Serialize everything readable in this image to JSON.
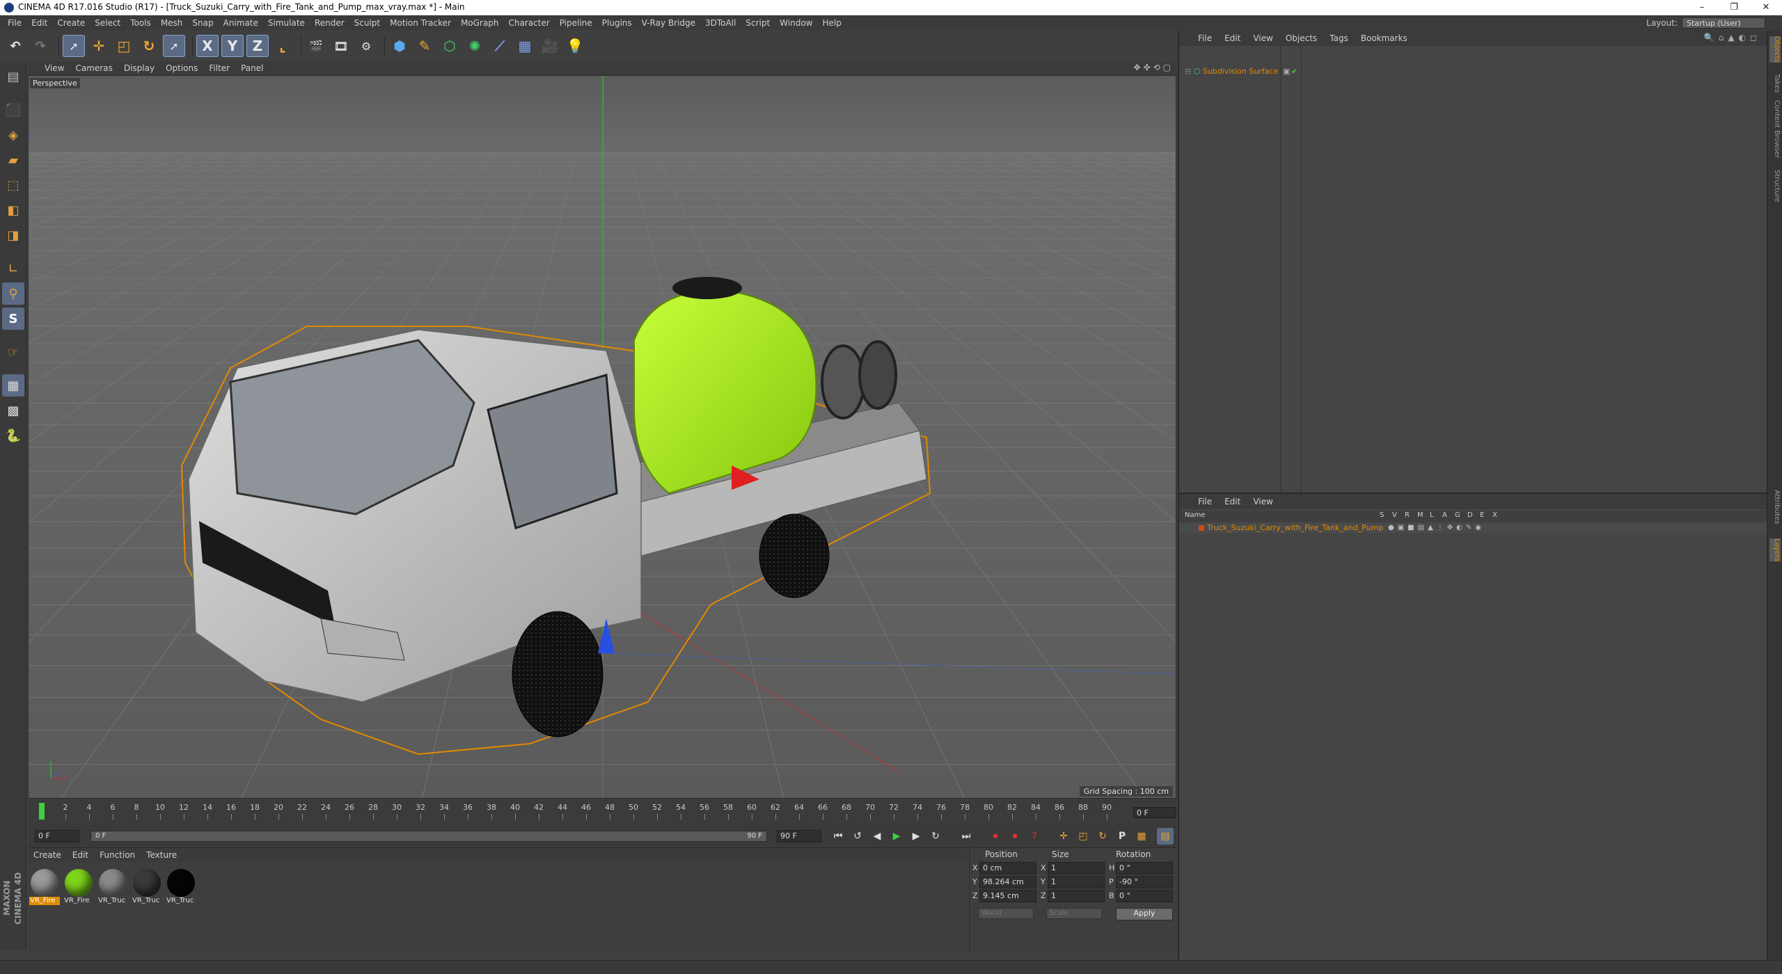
{
  "window": {
    "title": "CINEMA 4D R17.016 Studio (R17) - [Truck_Suzuki_Carry_with_Fire_Tank_and_Pump_max_vray.max *] - Main",
    "controls": {
      "minimize": "–",
      "restore": "❐",
      "close": "✕"
    }
  },
  "menubar": {
    "items": [
      "File",
      "Edit",
      "Create",
      "Select",
      "Tools",
      "Mesh",
      "Snap",
      "Animate",
      "Simulate",
      "Render",
      "Sculpt",
      "Motion Tracker",
      "MoGraph",
      "Character",
      "Pipeline",
      "Plugins",
      "V-Ray Bridge",
      "3DToAll",
      "Script",
      "Window",
      "Help"
    ],
    "layout_label": "Layout:",
    "layout_value": "Startup (User)"
  },
  "toolbar": {
    "axis_x": "X",
    "axis_y": "Y",
    "axis_z": "Z"
  },
  "viewport": {
    "menu": [
      "View",
      "Cameras",
      "Display",
      "Options",
      "Filter",
      "Panel"
    ],
    "label": "Perspective",
    "grid_spacing": "Grid Spacing : 100 cm"
  },
  "timeline": {
    "ticks": [
      0,
      2,
      4,
      6,
      8,
      10,
      12,
      14,
      16,
      18,
      20,
      22,
      24,
      26,
      28,
      30,
      32,
      34,
      36,
      38,
      40,
      42,
      44,
      46,
      48,
      50,
      52,
      54,
      56,
      58,
      60,
      62,
      64,
      66,
      68,
      70,
      72,
      74,
      76,
      78,
      80,
      82,
      84,
      86,
      88,
      90
    ],
    "current_frame": "0 F",
    "start_frame": "0 F",
    "range_start": "0 F",
    "range_end": "90 F",
    "end_frame": "90 F"
  },
  "materials": {
    "menu": [
      "Create",
      "Edit",
      "Function",
      "Texture"
    ],
    "items": [
      {
        "label": "VR_Fire",
        "color": "#9a9a9a",
        "selected": true
      },
      {
        "label": "VR_Fire",
        "color": "#7fd51a",
        "selected": false
      },
      {
        "label": "VR_Truc",
        "color": "#8a8a8a",
        "selected": false
      },
      {
        "label": "VR_Truc",
        "color": "#3a3a3a",
        "selected": false
      },
      {
        "label": "VR_Truc",
        "color": "#050505",
        "selected": false
      }
    ]
  },
  "coordinates": {
    "headers": {
      "position": "Position",
      "size": "Size",
      "rotation": "Rotation"
    },
    "rows": [
      {
        "axis": "X",
        "position": "0 cm",
        "size_axis": "X",
        "size": "1",
        "rot_axis": "H",
        "rotation": "0 °"
      },
      {
        "axis": "Y",
        "position": "98.264 cm",
        "size_axis": "Y",
        "size": "1",
        "rot_axis": "P",
        "rotation": "-90 °"
      },
      {
        "axis": "Z",
        "position": "9.145 cm",
        "size_axis": "Z",
        "size": "1",
        "rot_axis": "B",
        "rotation": "0 °"
      }
    ],
    "coord_mode": "World",
    "size_mode": "Scale",
    "apply_label": "Apply"
  },
  "object_manager": {
    "menu": [
      "File",
      "Edit",
      "View",
      "Objects",
      "Tags",
      "Bookmarks"
    ],
    "object_name": "Subdivision Surface"
  },
  "layer_manager": {
    "menu": [
      "File",
      "Edit",
      "View"
    ],
    "columns": [
      "Name",
      "S",
      "V",
      "R",
      "M",
      "L",
      "A",
      "G",
      "D",
      "E",
      "X"
    ],
    "layer_name": "Truck_Suzuki_Carry_with_Fire_Tank_and_Pump",
    "layer_color": "#d04a14"
  },
  "right_tabs": [
    "Objects",
    "Takes",
    "Content Browser",
    "Structure",
    "Attributes",
    "Layers"
  ],
  "brand": "MAXON CINEMA 4D",
  "colors": {
    "accent": "#e08a00",
    "selected_tool": "#5b6b85",
    "tank_green": "#a6ea1a"
  }
}
